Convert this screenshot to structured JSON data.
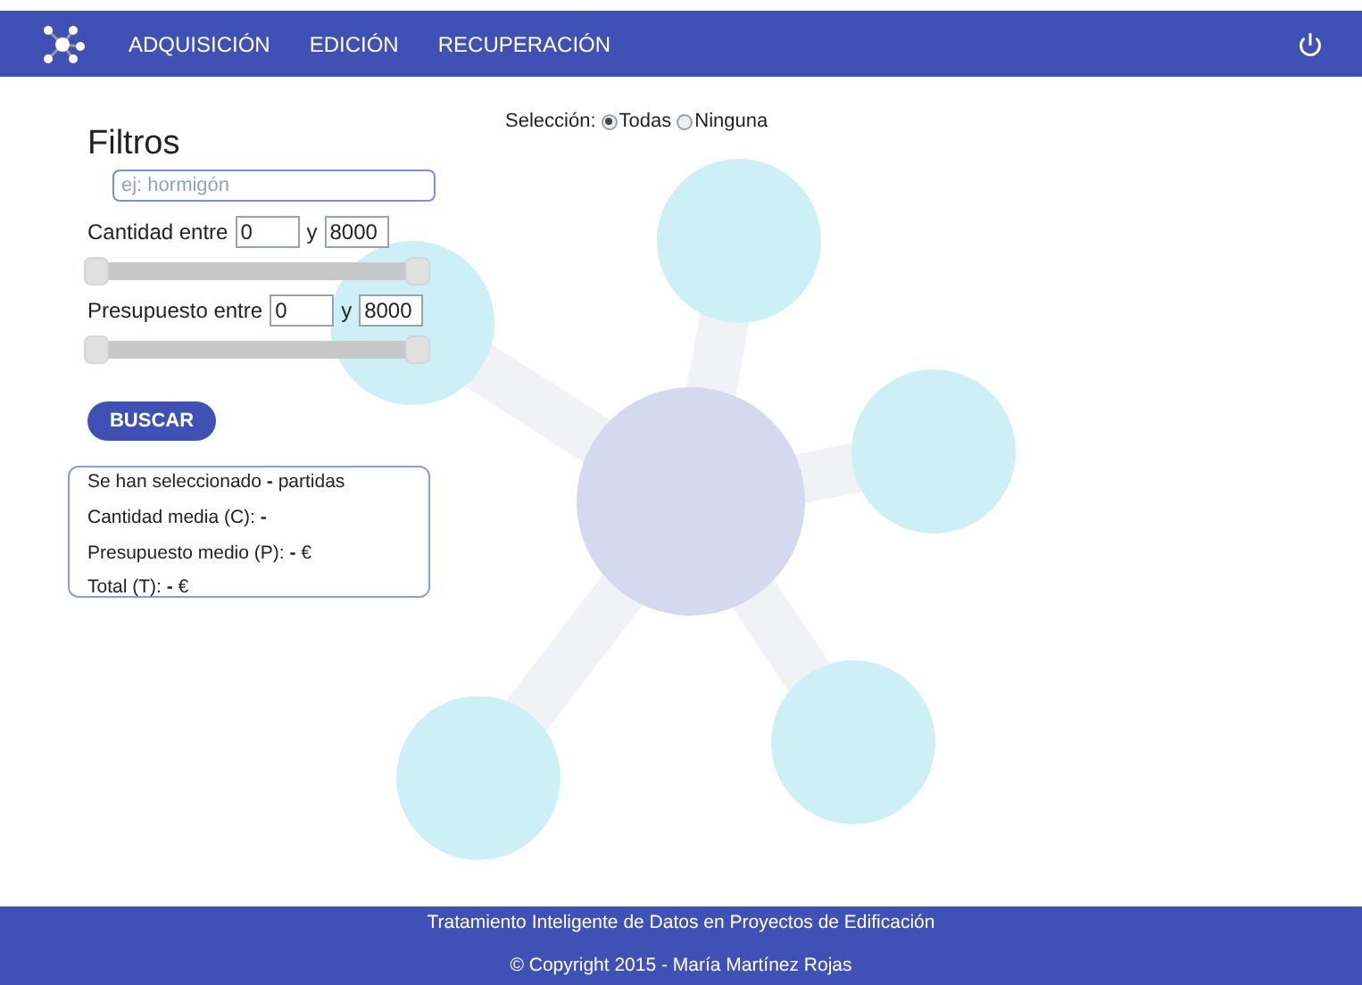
{
  "nav": {
    "items": [
      {
        "label": "ADQUISICIÓN"
      },
      {
        "label": "EDICIÓN"
      },
      {
        "label": "RECUPERACIÓN"
      }
    ]
  },
  "selection": {
    "label": "Selección:",
    "options": [
      {
        "label": "Todas",
        "selected": true
      },
      {
        "label": "Ninguna",
        "selected": false
      }
    ]
  },
  "filters": {
    "title": "Filtros",
    "search": {
      "placeholder": "ej: hormigón"
    },
    "ranges": [
      {
        "label": "Cantidad entre",
        "from": "0",
        "joiner": "y",
        "to": "8000",
        "level": 1
      },
      {
        "label": "Presupuesto entre",
        "from": "0",
        "joiner": "y",
        "to": "8000",
        "level": 1
      }
    ],
    "button": "BUSCAR"
  },
  "summary": [
    "Se han seleccionado **-** partidas",
    "Cantidad media (C): **-**",
    "Presupuesto medio (P): **-** €",
    "Total (T): **-** €"
  ],
  "footer": {
    "lines": [
      "Tratamiento Inteligente de Datos en Proyectos de Edificación",
      "© Copyright 2015 - María Martínez Rojas"
    ]
  }
}
